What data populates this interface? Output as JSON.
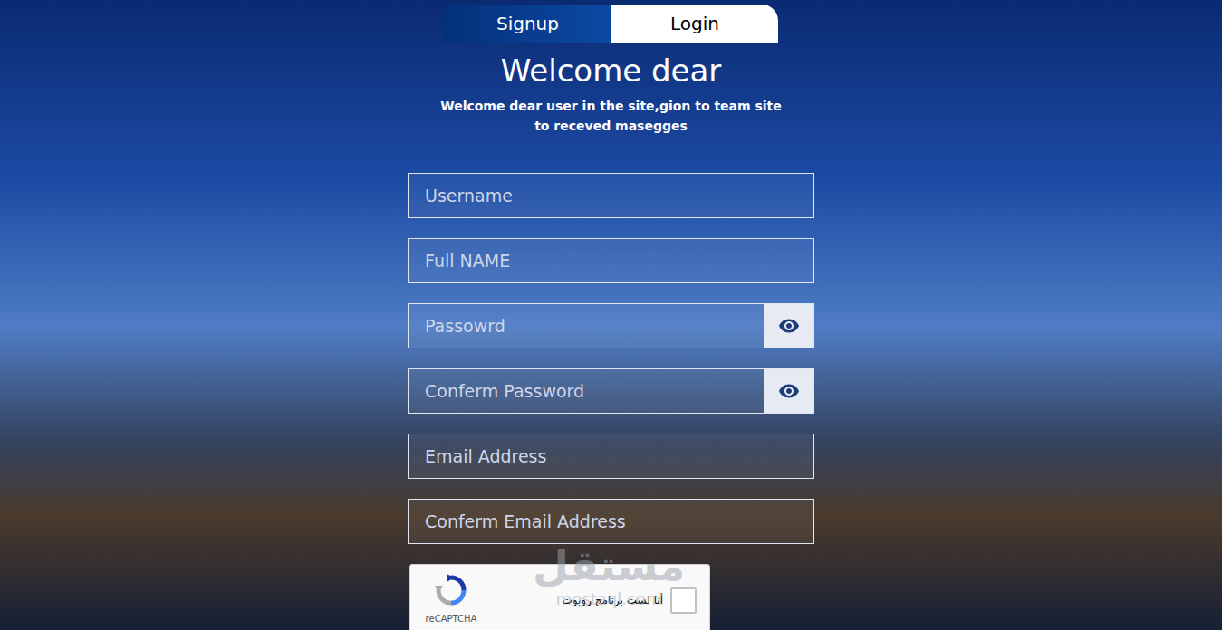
{
  "tabs": [
    {
      "label": "Signup",
      "selected": true
    },
    {
      "label": "Login",
      "selected": false
    }
  ],
  "heading": "Welcome dear",
  "subtitle": [
    "Welcome dear user in the site,gion to team site",
    "to receved masegges"
  ],
  "fields": [
    {
      "placeholder": "Username",
      "kind": "text"
    },
    {
      "placeholder": "Full NAME",
      "kind": "text"
    },
    {
      "placeholder": "Passowrd",
      "kind": "password"
    },
    {
      "placeholder": "Conferm Password",
      "kind": "password"
    },
    {
      "placeholder": "Email Address",
      "kind": "text"
    },
    {
      "placeholder": "Conferm Email Address",
      "kind": "text"
    }
  ],
  "captcha": {
    "label": "أنا لست برنامج روبوت",
    "brand": "reCAPTCHA",
    "checked": false
  },
  "watermark": {
    "text": "مستقل",
    "url": "mostaql.com"
  }
}
